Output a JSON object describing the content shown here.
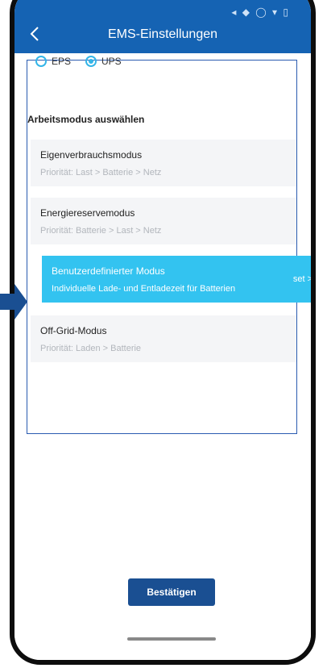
{
  "header": {
    "title": "EMS-Einstellungen",
    "status_icons": "◂ ◆ ◯ ▾ ▯"
  },
  "mode_toggle": {
    "options": [
      {
        "label": "EPS",
        "selected": false
      },
      {
        "label": "UPS",
        "selected": true
      }
    ]
  },
  "section_label": "Arbeitsmodus auswählen",
  "modes": [
    {
      "name": "Eigenverbrauchsmodus",
      "description": "Priorität: Last > Batterie > Netz"
    },
    {
      "name": "Energiereservemodus",
      "description": "Priorität: Batterie > Last > Netz"
    },
    {
      "name": "Benutzerdefinierter Modus",
      "description": "Individuelle Lade- und Entladezeit für Batterien",
      "action": "set >",
      "selected": true
    },
    {
      "name": "Off-Grid-Modus",
      "description": "Priorität: Laden > Batterie"
    }
  ],
  "confirm_label": "Bestätigen",
  "colors": {
    "header": "#1563b3",
    "selected_card": "#33c3f0",
    "confirm_button": "#1a4f92",
    "pointer_arrow": "#1a4f92"
  }
}
